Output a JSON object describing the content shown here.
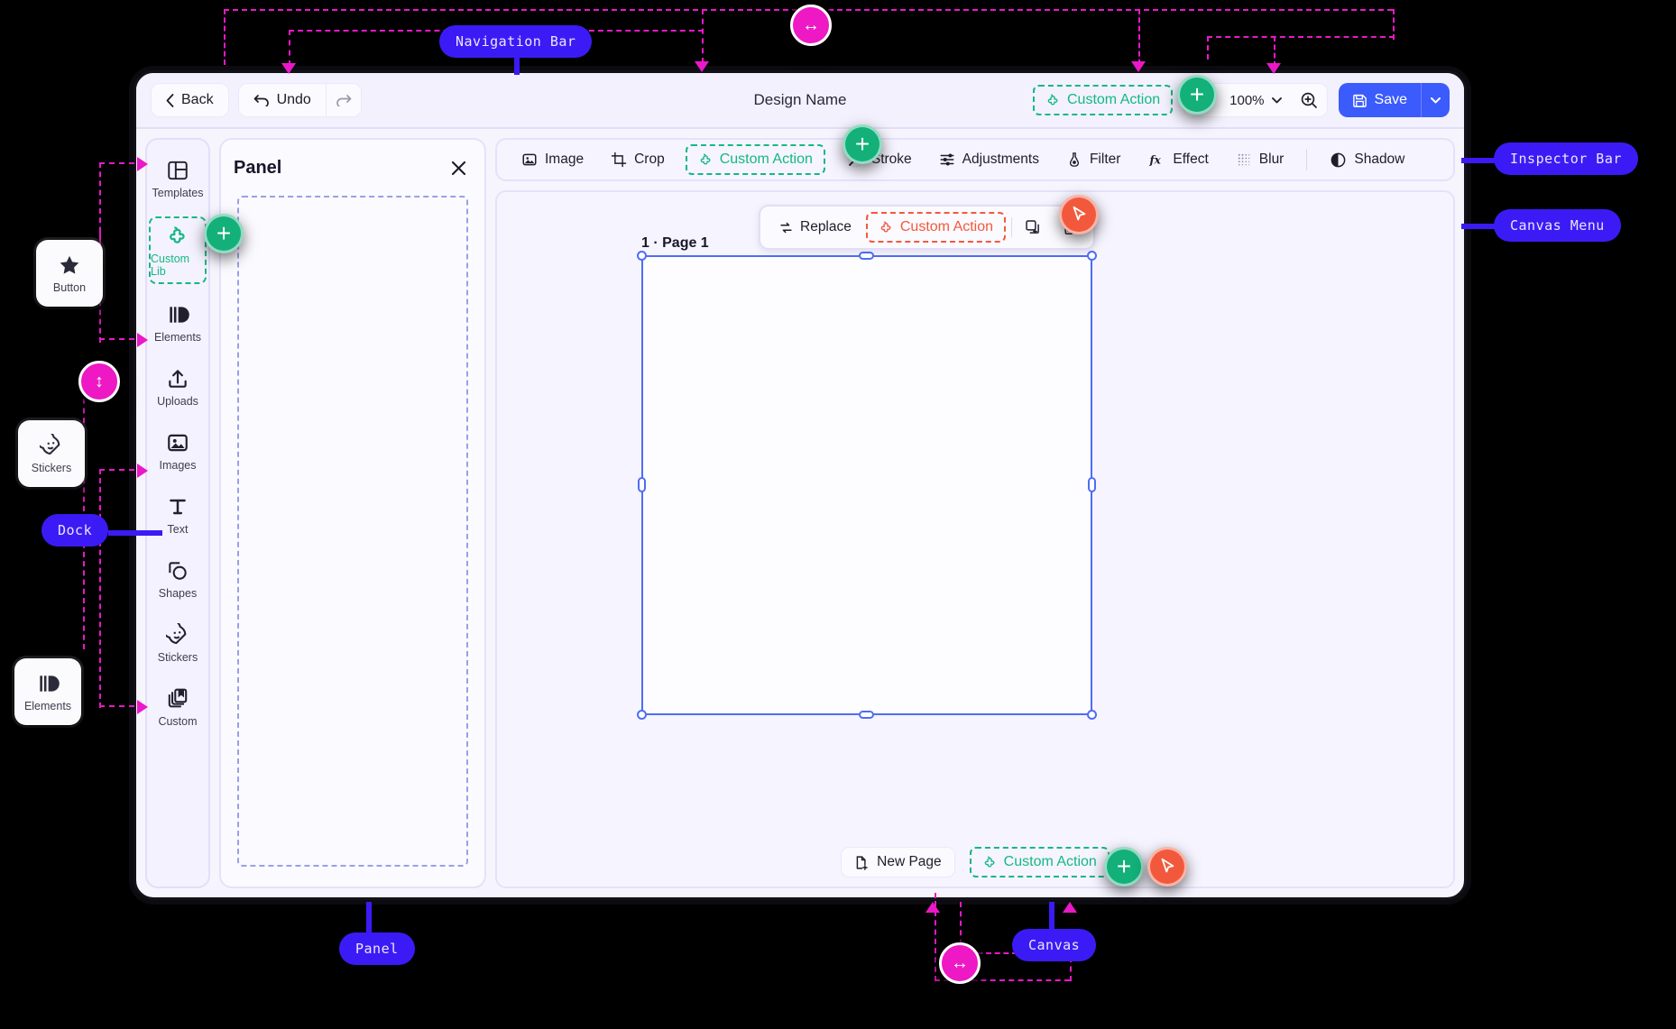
{
  "app": {
    "title": "Design Name",
    "navbar": {
      "back_label": "Back",
      "undo_label": "Undo",
      "redo_icon": "redo-icon",
      "custom_action_label": "Custom Action",
      "zoom_out_icon": "zoom-out-icon",
      "zoom_level": "100%",
      "zoom_in_icon": "zoom-in-icon",
      "save_label": "Save",
      "save_caret_icon": "chevron-down-icon"
    },
    "dock": {
      "items": [
        {
          "label": "Templates",
          "icon": "templates-icon",
          "active": false
        },
        {
          "label": "Custom Lib",
          "icon": "puzzle-icon",
          "active": true
        },
        {
          "label": "Elements",
          "icon": "elements-icon",
          "active": false
        },
        {
          "label": "Uploads",
          "icon": "upload-icon",
          "active": false
        },
        {
          "label": "Images",
          "icon": "image-icon",
          "active": false
        },
        {
          "label": "Text",
          "icon": "text-icon",
          "active": false
        },
        {
          "label": "Shapes",
          "icon": "shapes-icon",
          "active": false
        },
        {
          "label": "Stickers",
          "icon": "sticker-icon",
          "active": false
        },
        {
          "label": "Custom",
          "icon": "custom-stack-icon",
          "active": false
        }
      ]
    },
    "panel": {
      "title": "Panel",
      "close_icon": "close-icon"
    },
    "inspector": {
      "items": [
        {
          "label": "Image",
          "icon": "image-icon"
        },
        {
          "label": "Crop",
          "icon": "crop-icon"
        },
        {
          "label": "Custom Action",
          "icon": "puzzle-icon",
          "custom": true
        },
        {
          "label": "Stroke",
          "icon": "stroke-icon"
        },
        {
          "label": "Adjustments",
          "icon": "adjustments-icon"
        },
        {
          "label": "Filter",
          "icon": "filter-icon"
        },
        {
          "label": "Effect",
          "icon": "effect-icon"
        },
        {
          "label": "Blur",
          "icon": "blur-icon"
        },
        {
          "label": "Shadow",
          "icon": "shadow-icon"
        }
      ]
    },
    "canvas": {
      "page_label": "1 · Page 1",
      "menu": {
        "replace_label": "Replace",
        "custom_action_label": "Custom Action",
        "duplicate_icon": "duplicate-icon",
        "delete_icon": "trash-icon"
      },
      "bottom": {
        "new_page_label": "New Page",
        "custom_action_label": "Custom Action"
      }
    }
  },
  "annotations": {
    "labels": [
      {
        "id": "navigation-bar",
        "text": "Navigation Bar"
      },
      {
        "id": "inspector-bar",
        "text": "Inspector Bar"
      },
      {
        "id": "canvas-menu",
        "text": "Canvas Menu"
      },
      {
        "id": "dock",
        "text": "Dock"
      },
      {
        "id": "panel",
        "text": "Panel"
      },
      {
        "id": "canvas",
        "text": "Canvas"
      }
    ],
    "float_cards": [
      {
        "label": "Button",
        "icon": "star-icon"
      },
      {
        "label": "Stickers",
        "icon": "sticker-icon"
      },
      {
        "label": "Elements",
        "icon": "elements-icon"
      }
    ],
    "markers": [
      {
        "id": "resize-h-top",
        "kind": "pink",
        "glyph": "↔"
      },
      {
        "id": "add-navbar",
        "kind": "green",
        "glyph": "+"
      },
      {
        "id": "add-inspector",
        "kind": "green",
        "glyph": "+"
      },
      {
        "id": "add-dock",
        "kind": "green",
        "glyph": "+"
      },
      {
        "id": "cursor-canvas-menu",
        "kind": "red",
        "glyph": "cursor"
      },
      {
        "id": "resize-v-dock",
        "kind": "pink",
        "glyph": "↕"
      },
      {
        "id": "add-canvas-bottom",
        "kind": "green",
        "glyph": "+"
      },
      {
        "id": "cursor-canvas-bottom",
        "kind": "red",
        "glyph": "cursor"
      },
      {
        "id": "resize-h-bottom",
        "kind": "pink",
        "glyph": "↔"
      }
    ]
  },
  "colors": {
    "accent_blue": "#3b5bfd",
    "annotation_blue": "#3b1bf5",
    "guide_magenta": "#ea18c8",
    "custom_green": "#14b884",
    "custom_red": "#f2593c"
  }
}
